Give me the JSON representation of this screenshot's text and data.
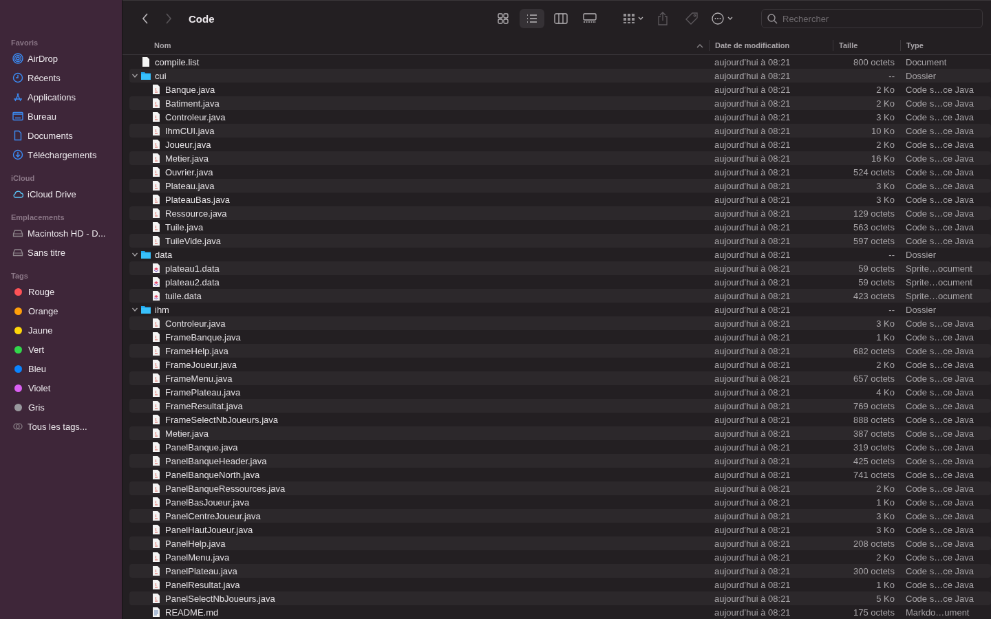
{
  "sidebar": {
    "sections": [
      {
        "title": "Favoris",
        "items": [
          {
            "label": "AirDrop",
            "kind": "airdrop"
          },
          {
            "label": "Récents",
            "kind": "clock"
          },
          {
            "label": "Applications",
            "kind": "apps"
          },
          {
            "label": "Bureau",
            "kind": "desktop"
          },
          {
            "label": "Documents",
            "kind": "document"
          },
          {
            "label": "Téléchargements",
            "kind": "download"
          }
        ]
      },
      {
        "title": "iCloud",
        "items": [
          {
            "label": "iCloud Drive",
            "kind": "cloud"
          }
        ]
      },
      {
        "title": "Emplacements",
        "items": [
          {
            "label": "Macintosh HD - D...",
            "kind": "disk"
          },
          {
            "label": "Sans titre",
            "kind": "disk"
          }
        ]
      },
      {
        "title": "Tags",
        "items": [
          {
            "label": "Rouge",
            "kind": "tag",
            "color": "#ff5257"
          },
          {
            "label": "Orange",
            "kind": "tag",
            "color": "#ff9f0a"
          },
          {
            "label": "Jaune",
            "kind": "tag",
            "color": "#ffd60a"
          },
          {
            "label": "Vert",
            "kind": "tag",
            "color": "#32d74b"
          },
          {
            "label": "Bleu",
            "kind": "tag",
            "color": "#0a84ff"
          },
          {
            "label": "Violet",
            "kind": "tag",
            "color": "#da5ff2"
          },
          {
            "label": "Gris",
            "kind": "tag",
            "color": "#98989d"
          },
          {
            "label": "Tous les tags...",
            "kind": "alltags"
          }
        ]
      }
    ]
  },
  "toolbar": {
    "title": "Code",
    "back_disabled": false,
    "forward_disabled": true,
    "views": [
      {
        "kind": "icons",
        "selected": false
      },
      {
        "kind": "list",
        "selected": true
      },
      {
        "kind": "columns",
        "selected": false
      },
      {
        "kind": "gallery",
        "selected": false
      }
    ],
    "actions": [
      {
        "kind": "group",
        "disabled": false
      },
      {
        "kind": "share",
        "disabled": true
      },
      {
        "kind": "tag",
        "disabled": true
      },
      {
        "kind": "more",
        "disabled": false
      }
    ],
    "search": {
      "placeholder": "Rechercher"
    }
  },
  "columns": [
    {
      "label": "Nom",
      "sorted": true
    },
    {
      "label": "Date de modification",
      "sorted": false
    },
    {
      "label": "Taille",
      "sorted": false
    },
    {
      "label": "Type",
      "sorted": false
    }
  ],
  "rows": [
    {
      "name": "compile.list",
      "kind": "text",
      "date": "aujourd’hui à 08:21",
      "size": "800 octets",
      "type": "Document"
    },
    {
      "name": "cui",
      "kind": "folder",
      "expanded": true,
      "date": "aujourd’hui à 08:21",
      "size": "--",
      "type": "Dossier",
      "children": [
        {
          "name": "Banque.java",
          "kind": "java",
          "date": "aujourd’hui à 08:21",
          "size": "2 Ko",
          "type": "Code s…ce Java"
        },
        {
          "name": "Batiment.java",
          "kind": "java",
          "date": "aujourd’hui à 08:21",
          "size": "2 Ko",
          "type": "Code s…ce Java"
        },
        {
          "name": "Controleur.java",
          "kind": "java",
          "date": "aujourd’hui à 08:21",
          "size": "3 Ko",
          "type": "Code s…ce Java"
        },
        {
          "name": "IhmCUI.java",
          "kind": "java",
          "date": "aujourd’hui à 08:21",
          "size": "10 Ko",
          "type": "Code s…ce Java"
        },
        {
          "name": "Joueur.java",
          "kind": "java",
          "date": "aujourd’hui à 08:21",
          "size": "2 Ko",
          "type": "Code s…ce Java"
        },
        {
          "name": "Metier.java",
          "kind": "java",
          "date": "aujourd’hui à 08:21",
          "size": "16 Ko",
          "type": "Code s…ce Java"
        },
        {
          "name": "Ouvrier.java",
          "kind": "java",
          "date": "aujourd’hui à 08:21",
          "size": "524 octets",
          "type": "Code s…ce Java"
        },
        {
          "name": "Plateau.java",
          "kind": "java",
          "date": "aujourd’hui à 08:21",
          "size": "3 Ko",
          "type": "Code s…ce Java"
        },
        {
          "name": "PlateauBas.java",
          "kind": "java",
          "date": "aujourd’hui à 08:21",
          "size": "3 Ko",
          "type": "Code s…ce Java"
        },
        {
          "name": "Ressource.java",
          "kind": "java",
          "date": "aujourd’hui à 08:21",
          "size": "129 octets",
          "type": "Code s…ce Java"
        },
        {
          "name": "Tuile.java",
          "kind": "java",
          "date": "aujourd’hui à 08:21",
          "size": "563 octets",
          "type": "Code s…ce Java"
        },
        {
          "name": "TuileVide.java",
          "kind": "java",
          "date": "aujourd’hui à 08:21",
          "size": "597 octets",
          "type": "Code s…ce Java"
        }
      ]
    },
    {
      "name": "data",
      "kind": "folder",
      "expanded": true,
      "date": "aujourd’hui à 08:21",
      "size": "--",
      "type": "Dossier",
      "children": [
        {
          "name": "plateau1.data",
          "kind": "data",
          "date": "aujourd’hui à 08:21",
          "size": "59 octets",
          "type": "Sprite…ocument"
        },
        {
          "name": "plateau2.data",
          "kind": "data",
          "date": "aujourd’hui à 08:21",
          "size": "59 octets",
          "type": "Sprite…ocument"
        },
        {
          "name": "tuile.data",
          "kind": "data",
          "date": "aujourd’hui à 08:21",
          "size": "423 octets",
          "type": "Sprite…ocument"
        }
      ]
    },
    {
      "name": "ihm",
      "kind": "folder",
      "expanded": true,
      "date": "aujourd’hui à 08:21",
      "size": "--",
      "type": "Dossier",
      "children": [
        {
          "name": "Controleur.java",
          "kind": "java",
          "date": "aujourd’hui à 08:21",
          "size": "3 Ko",
          "type": "Code s…ce Java"
        },
        {
          "name": "FrameBanque.java",
          "kind": "java",
          "date": "aujourd’hui à 08:21",
          "size": "1 Ko",
          "type": "Code s…ce Java"
        },
        {
          "name": "FrameHelp.java",
          "kind": "java",
          "date": "aujourd’hui à 08:21",
          "size": "682 octets",
          "type": "Code s…ce Java"
        },
        {
          "name": "FrameJoueur.java",
          "kind": "java",
          "date": "aujourd’hui à 08:21",
          "size": "2 Ko",
          "type": "Code s…ce Java"
        },
        {
          "name": "FrameMenu.java",
          "kind": "java",
          "date": "aujourd’hui à 08:21",
          "size": "657 octets",
          "type": "Code s…ce Java"
        },
        {
          "name": "FramePlateau.java",
          "kind": "java",
          "date": "aujourd’hui à 08:21",
          "size": "4 Ko",
          "type": "Code s…ce Java"
        },
        {
          "name": "FrameResultat.java",
          "kind": "java",
          "date": "aujourd’hui à 08:21",
          "size": "769 octets",
          "type": "Code s…ce Java"
        },
        {
          "name": "FrameSelectNbJoueurs.java",
          "kind": "java",
          "date": "aujourd’hui à 08:21",
          "size": "888 octets",
          "type": "Code s…ce Java"
        },
        {
          "name": "Metier.java",
          "kind": "java",
          "date": "aujourd’hui à 08:21",
          "size": "387 octets",
          "type": "Code s…ce Java"
        },
        {
          "name": "PanelBanque.java",
          "kind": "java",
          "date": "aujourd’hui à 08:21",
          "size": "319 octets",
          "type": "Code s…ce Java"
        },
        {
          "name": "PanelBanqueHeader.java",
          "kind": "java",
          "date": "aujourd’hui à 08:21",
          "size": "425 octets",
          "type": "Code s…ce Java"
        },
        {
          "name": "PanelBanqueNorth.java",
          "kind": "java",
          "date": "aujourd’hui à 08:21",
          "size": "741 octets",
          "type": "Code s…ce Java"
        },
        {
          "name": "PanelBanqueRessources.java",
          "kind": "java",
          "date": "aujourd’hui à 08:21",
          "size": "2 Ko",
          "type": "Code s…ce Java"
        },
        {
          "name": "PanelBasJoueur.java",
          "kind": "java",
          "date": "aujourd’hui à 08:21",
          "size": "1 Ko",
          "type": "Code s…ce Java"
        },
        {
          "name": "PanelCentreJoueur.java",
          "kind": "java",
          "date": "aujourd’hui à 08:21",
          "size": "3 Ko",
          "type": "Code s…ce Java"
        },
        {
          "name": "PanelHautJoueur.java",
          "kind": "java",
          "date": "aujourd’hui à 08:21",
          "size": "3 Ko",
          "type": "Code s…ce Java"
        },
        {
          "name": "PanelHelp.java",
          "kind": "java",
          "date": "aujourd’hui à 08:21",
          "size": "208 octets",
          "type": "Code s…ce Java"
        },
        {
          "name": "PanelMenu.java",
          "kind": "java",
          "date": "aujourd’hui à 08:21",
          "size": "2 Ko",
          "type": "Code s…ce Java"
        },
        {
          "name": "PanelPlateau.java",
          "kind": "java",
          "date": "aujourd’hui à 08:21",
          "size": "300 octets",
          "type": "Code s…ce Java"
        },
        {
          "name": "PanelResultat.java",
          "kind": "java",
          "date": "aujourd’hui à 08:21",
          "size": "1 Ko",
          "type": "Code s…ce Java"
        },
        {
          "name": "PanelSelectNbJoueurs.java",
          "kind": "java",
          "date": "aujourd’hui à 08:21",
          "size": "5 Ko",
          "type": "Code s…ce Java"
        },
        {
          "name": "README.md",
          "kind": "markdown",
          "date": "aujourd’hui à 08:21",
          "size": "175 octets",
          "type": "Markdo…ument"
        }
      ]
    }
  ]
}
